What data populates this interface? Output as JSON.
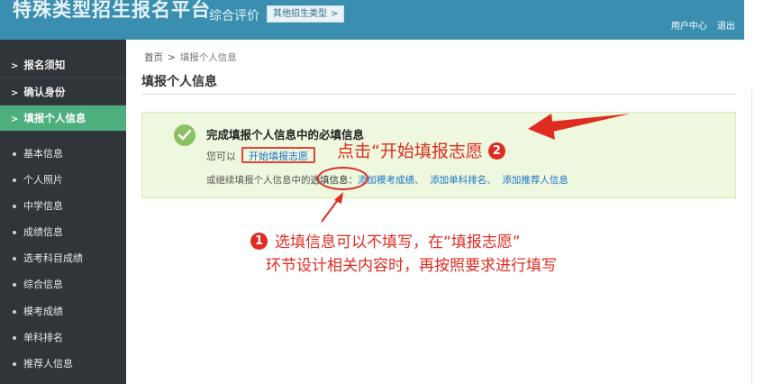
{
  "header": {
    "brand": "特殊类型招生报名平台",
    "subtitle": "综合评价",
    "type_button": "其他招生类型",
    "type_chevron": ">",
    "links": [
      "用户中心",
      "退出"
    ]
  },
  "sidebar": {
    "items": [
      {
        "label": "报名须知",
        "arrow": ">"
      },
      {
        "label": "确认身份",
        "arrow": ">"
      },
      {
        "label": "填报个人信息",
        "arrow": ">"
      }
    ],
    "sub_items": [
      "基本信息",
      "个人照片",
      "中学信息",
      "成绩信息",
      "选考科目成绩",
      "综合信息",
      "模考成绩",
      "单科排名",
      "推荐人信息"
    ]
  },
  "breadcrumb": {
    "home": "首页",
    "sep": ">",
    "current": "填报个人信息"
  },
  "page_title": "填报个人信息",
  "info": {
    "heading": "完成填报个人信息中的必填信息",
    "prefix": "您可以",
    "start_link": "开始填报志愿",
    "row2_prefix": "或继续填报个人信息中的",
    "optional_label": "选填信息",
    "row2_colon": "：",
    "links": [
      "添加模考成绩、",
      "添加单科排名、",
      "添加推荐人信息"
    ]
  },
  "annotations": {
    "note2": "点击“开始填报志愿",
    "num2": "2",
    "num1": "1",
    "note1_line1": "选填信息可以不填写，在“填报志愿”",
    "note1_line2": "环节设计相关内容时，再按照要求进行填写"
  },
  "colors": {
    "header": "#3a8fb0",
    "sidebar": "#2f3538",
    "active": "#4caf7d",
    "annotation": "#e02b20",
    "link": "#1a73c8"
  }
}
